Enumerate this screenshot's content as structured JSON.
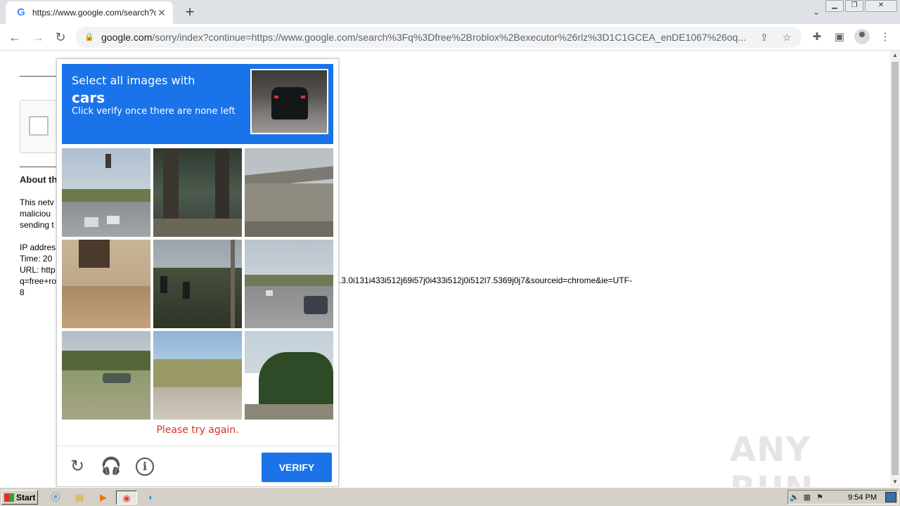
{
  "browser": {
    "tab_title": "https://www.google.com/search?q=",
    "favicon_letter": "G",
    "url_host": "google.com",
    "url_rest": "/sorry/index?continue=https://www.google.com/search%3Fq%3Dfree%2Broblox%2Bexecutor%26rlz%3D1C1GCEA_enDE1067%26oq..."
  },
  "page": {
    "about_heading": "About th",
    "lines": [
      "This netv",
      "maliciou",
      "sending t",
      "",
      "IP addres",
      "Time: 20",
      "URL: http",
      "q=free+ro",
      "8"
    ],
    "url_tail": ".3.0i131i433i512j69i57j0i433i512j0i512l7.5369j0j7&sourceid=chrome&ie=UTF-"
  },
  "captcha": {
    "instruction_line1": "Select all images with",
    "target": "cars",
    "instruction_line3": "Click verify once there are none left",
    "error": "Please try again.",
    "verify_label": "VERIFY"
  },
  "watermark": "ANY RUN",
  "taskbar": {
    "start_label": "Start",
    "clock": "9:54 PM"
  }
}
